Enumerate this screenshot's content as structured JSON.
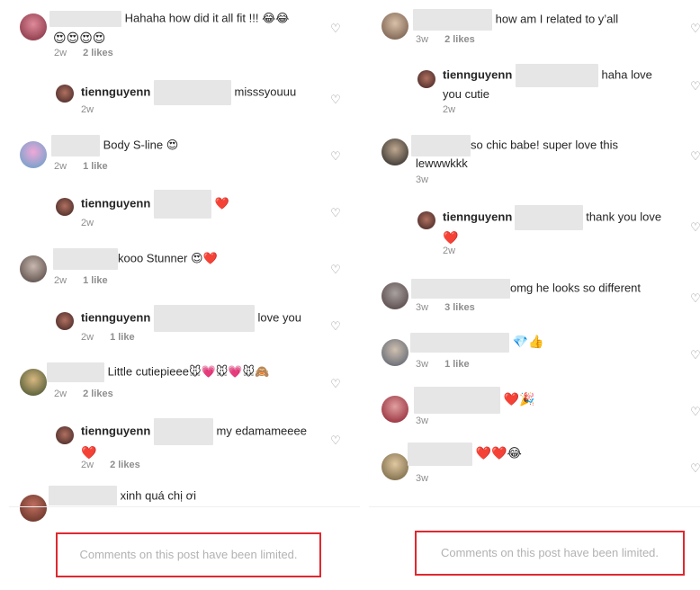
{
  "left": {
    "comments": [
      {
        "text": "Hahaha how did it all fit !!! 😂😂",
        "text2": "😍😍😍😍",
        "time": "2w",
        "likes": "2 likes"
      },
      {
        "user": "tiennguyenn",
        "text": "misssyouuu",
        "time": "2w"
      },
      {
        "text": "Body S-line 😍",
        "time": "2w",
        "likes": "1 like"
      },
      {
        "user": "tiennguyenn",
        "text": "❤️",
        "time": "2w"
      },
      {
        "text": "kooo Stunner 😍❤️",
        "time": "2w",
        "likes": "1 like"
      },
      {
        "user": "tiennguyenn",
        "text": "love you",
        "time": "2w",
        "likes": "1 like"
      },
      {
        "text": "Little cutiepieee🐭💗🐭💗🐭🙈",
        "time": "2w",
        "likes": "2 likes"
      },
      {
        "user": "tiennguyenn",
        "text": "my edamameeee",
        "text2": "❤️",
        "time": "2w",
        "likes": "2 likes"
      },
      {
        "text": "xinh quá chị ơi"
      }
    ],
    "limited": "Comments on this post have been limited."
  },
  "right": {
    "comments": [
      {
        "text": "how am I related to y’all",
        "time": "3w",
        "likes": "2 likes"
      },
      {
        "user": "tiennguyenn",
        "text": "haha love",
        "text2": "you cutie",
        "time": "2w"
      },
      {
        "text": "so chic babe! super love this",
        "text2": "lewwwkkk",
        "time": "3w"
      },
      {
        "user": "tiennguyenn",
        "text": "thank you love",
        "text2": "❤️",
        "time": "2w"
      },
      {
        "text": "omg he looks so different",
        "time": "3w",
        "likes": "3 likes"
      },
      {
        "text": "💎👍",
        "time": "3w",
        "likes": "1 like"
      },
      {
        "text": "❤️🎉",
        "time": "3w"
      },
      {
        "text": "❤️❤️😂",
        "time": "3w"
      }
    ],
    "limited": "Comments on this post have been limited."
  },
  "icons": {
    "like": "heart-outline-icon"
  },
  "colors": {
    "limited_border": "#e0282f",
    "meta": "#8e8e8e",
    "redaction": "#e6e6e6"
  }
}
